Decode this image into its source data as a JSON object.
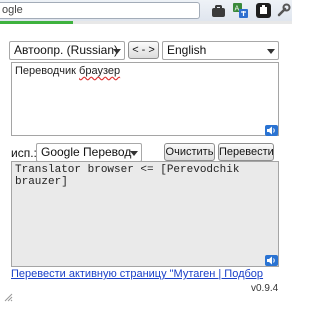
{
  "browser": {
    "url_fragment": "ogle",
    "icons": [
      "briefcase-icon",
      "translate-extension-icon",
      "puzzle-extension-icon",
      "wrench-icon"
    ],
    "load_progress": 0.25,
    "accent_green": "#3eb23e"
  },
  "translator": {
    "source_lang": "Автоопр. (Russian)",
    "swap_label": "< - >",
    "target_lang": "English",
    "source_word1": "Переводчик",
    "source_word2": "браузер",
    "engine_label": "исп.:",
    "engine": "Google Перевод",
    "clear_label": "Очистить",
    "translate_label": "Перевести",
    "result_text": "Translator browser <= [Perevodchik brauzer]",
    "page_link": "Перевести активную страницу \"Мутаген | Подбор",
    "version": "v0.9.4",
    "link_color": "#1a40c8"
  }
}
